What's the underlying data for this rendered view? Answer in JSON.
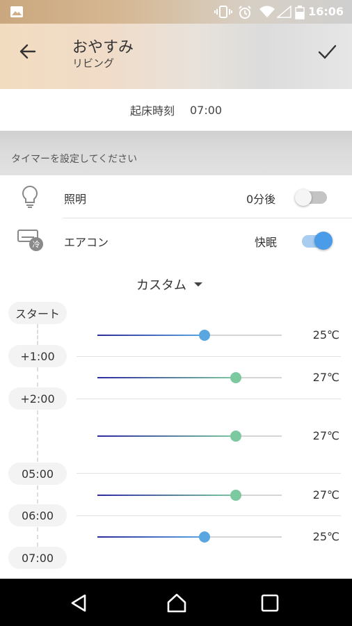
{
  "status_bar": {
    "time": "16:06"
  },
  "header": {
    "title": "おやすみ",
    "subtitle": "リビング"
  },
  "wake": {
    "label": "起床時刻",
    "time": "07:00"
  },
  "timer_banner": {
    "text": "タイマーを設定してください"
  },
  "devices": [
    {
      "name": "照明",
      "value": "0分後",
      "on": false,
      "icon": "lightbulb-icon"
    },
    {
      "name": "エアコン",
      "value": "快眠",
      "on": true,
      "icon": "aircon-icon"
    }
  ],
  "mode": {
    "label": "カスタム"
  },
  "timeline": {
    "markers": [
      "スタート",
      "+1:00",
      "+2:00",
      "05:00",
      "06:00",
      "07:00"
    ],
    "temps": [
      {
        "value": "25℃",
        "level": 0.58
      },
      {
        "value": "27℃",
        "level": 0.75
      },
      {
        "value": "27℃",
        "level": 0.75
      },
      {
        "value": "27℃",
        "level": 0.75
      },
      {
        "value": "25℃",
        "level": 0.58
      }
    ]
  },
  "colors": {
    "accent": "#4a9be8",
    "knob_blue": "#5aa6e0",
    "knob_green": "#7cc9a0",
    "fill_start": "#2d2aa0"
  }
}
